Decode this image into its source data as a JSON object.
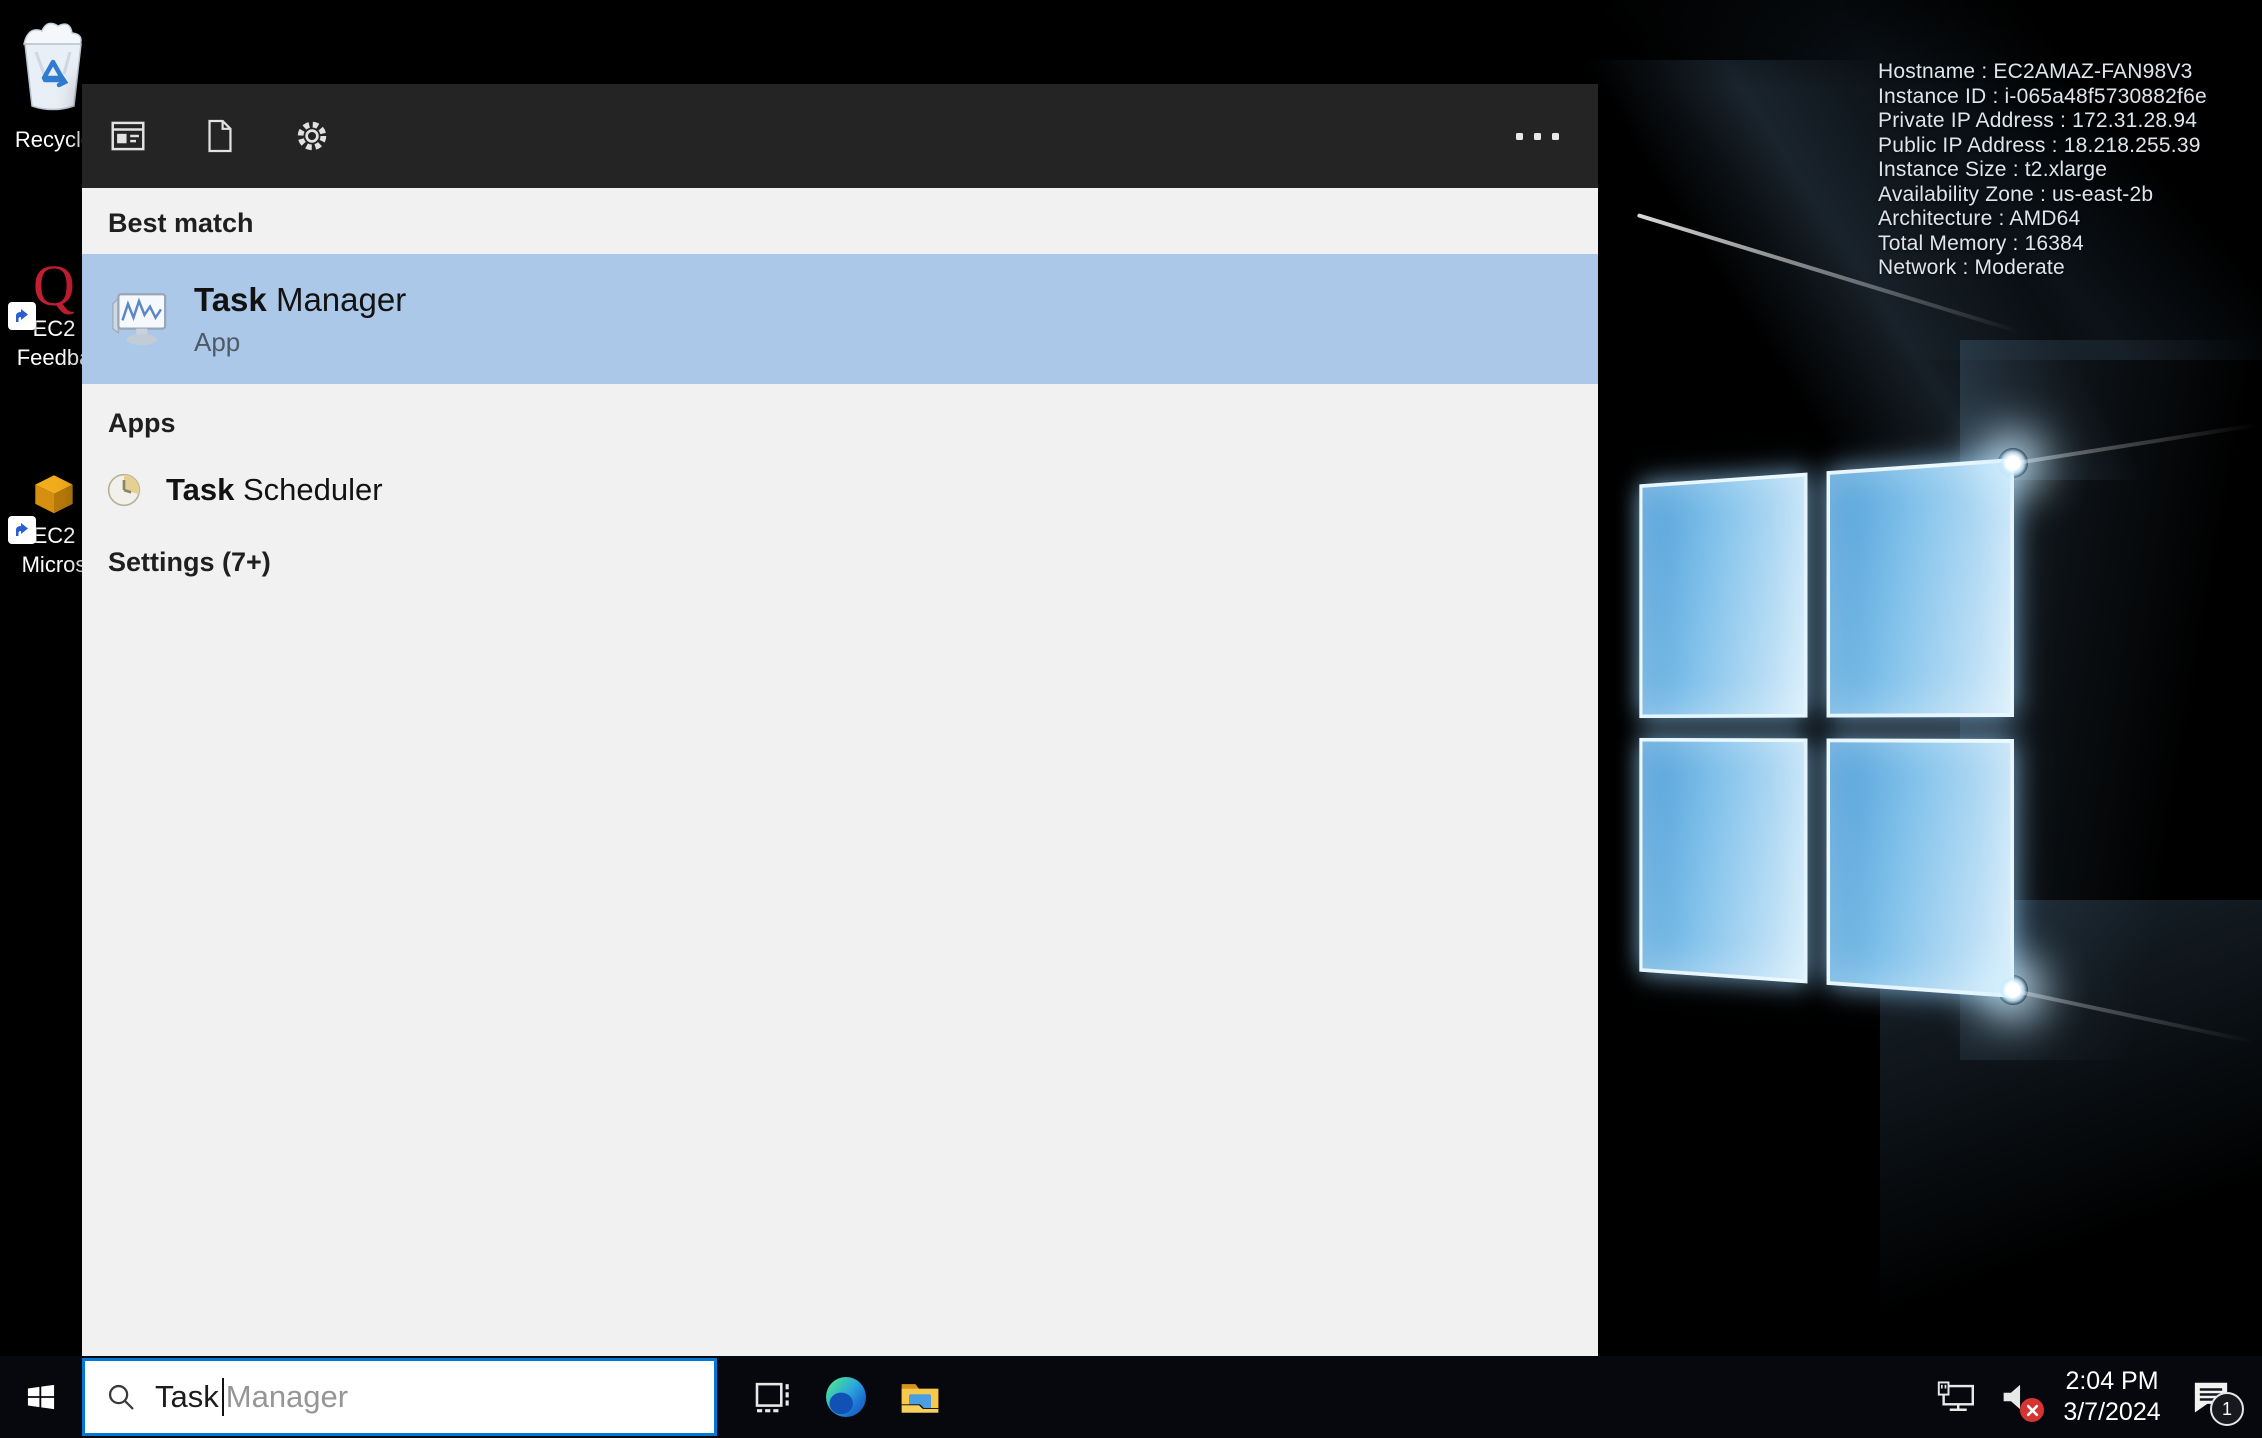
{
  "wallpaper_info": {
    "lines": [
      "Hostname : EC2AMAZ-FAN98V3",
      "Instance ID : i-065a48f5730882f6e",
      "Private IP Address : 172.31.28.94",
      "Public IP Address : 18.218.255.39",
      "Instance Size : t2.xlarge",
      "Availability Zone : us-east-2b",
      "Architecture : AMD64",
      "Total Memory : 16384",
      "Network : Moderate"
    ]
  },
  "desktop_icons": {
    "recycle_bin_label": "Recycle",
    "ec2_feedback_label_line1": "EC2",
    "ec2_feedback_label_line2": "Feedba",
    "ec2_microsoft_label_line1": "EC2",
    "ec2_microsoft_label_line2": "Micros"
  },
  "search_panel": {
    "best_match_header": "Best match",
    "best_match": {
      "title_match": "Task",
      "title_rest": " Manager",
      "subtitle": "App"
    },
    "apps_header": "Apps",
    "apps_item": {
      "title_match": "Task",
      "title_rest": " Scheduler"
    },
    "settings_header": "Settings (7+)"
  },
  "taskbar": {
    "search_typed": "Task",
    "search_suggestion": "Manager",
    "clock_time": "2:04 PM",
    "clock_date": "3/7/2024",
    "notification_count": "1"
  },
  "colors": {
    "accent_blue": "#0078d7",
    "selection_blue": "#abc8e8",
    "panel_gray": "#f1f1f1",
    "panel_header_dark": "#242424",
    "taskbar_black": "#07080d",
    "mute_badge_red": "#d63333"
  }
}
